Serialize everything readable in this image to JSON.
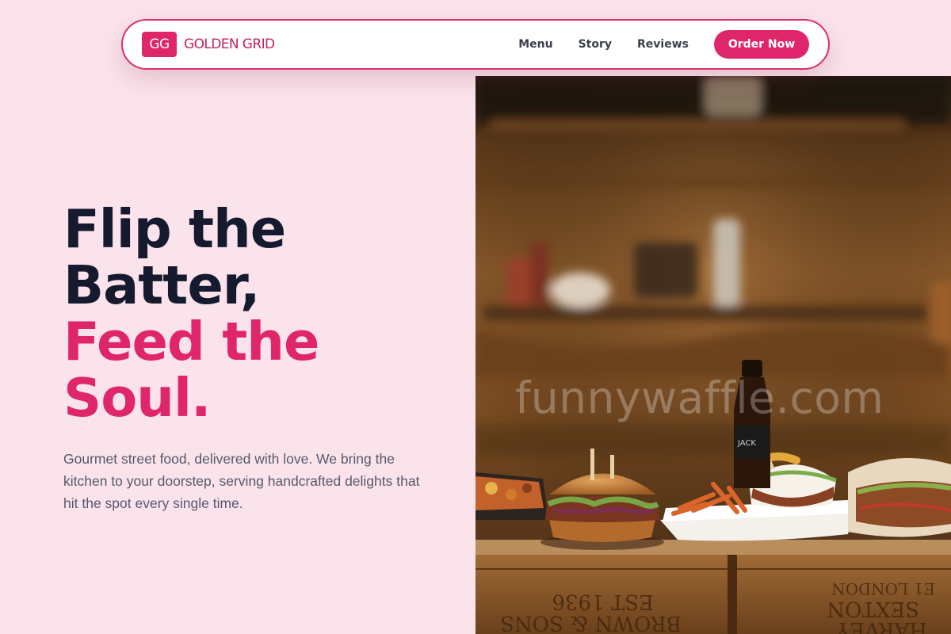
{
  "brand": {
    "initials": "GG",
    "name": "GOLDEN GRID"
  },
  "nav": {
    "links": [
      "Menu",
      "Story",
      "Reviews"
    ],
    "cta_label": "Order Now"
  },
  "hero": {
    "title_dark_1": "Flip the",
    "title_dark_2": "Batter,",
    "title_pink_1": "Feed the",
    "title_pink_2": "Soul.",
    "subtitle": "Gourmet street food, delivered with love. We bring the kitchen to your doorstep, serving handcrafted delights that hit the spot every single time."
  },
  "image": {
    "watermark": "funnywaffle.com",
    "crate_text_left_1": "EST 1936",
    "crate_text_left_2": "BROWN & SONS",
    "crate_text_right_1": "E1 LONDON",
    "crate_text_right_2": "SEXTON",
    "crate_text_right_3": "HARVEY",
    "sauce_label": "JACK"
  },
  "colors": {
    "accent": "#e0266b",
    "background": "#fbe3ec",
    "heading": "#161a2e"
  }
}
